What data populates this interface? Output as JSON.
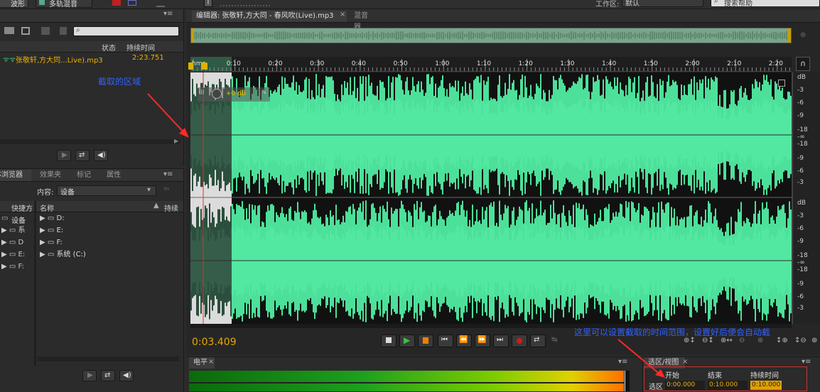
{
  "menubar": {
    "waveform_tab": "波形",
    "multitrack_tab": "多轨混音",
    "workspace_label": "工作区:",
    "workspace_value": "默认",
    "help_search_placeholder": "搜索帮助"
  },
  "files_panel": {
    "col_status": "状态",
    "col_duration": "持续时间",
    "files": [
      {
        "name": "张敬轩,方大同...Live).mp3",
        "duration": "2:23.751"
      }
    ]
  },
  "annotations": {
    "capture_region": "截取的区域",
    "time_range_hint": "这里可以设置截取的时间范围，设置好后便会自动截"
  },
  "browser_panel": {
    "tabs": [
      "媒体浏览器",
      "效果夹",
      "标记",
      "属性"
    ],
    "content_label": "内容:",
    "content_value": "设备",
    "shortcuts_label": "快捷方",
    "devices_label": "设备",
    "left_items": [
      "系",
      "D",
      "E:",
      "F:"
    ],
    "col_name": "名称",
    "col_duration": "持续",
    "drives": [
      "D:",
      "E:",
      "F:",
      "系统 (C:)"
    ]
  },
  "editor": {
    "tab_label": "编辑器: 张敬轩,方大同 - 春风吹(Live).mp3",
    "mixer_tab": "混音器",
    "hud_gain": "+0 dB",
    "current_time": "0:03.409",
    "ruler": [
      "hms",
      "0:10",
      "0:20",
      "0:30",
      "0:40",
      "0:50",
      "1:00",
      "1:10",
      "1:20",
      "1:30",
      "1:40",
      "1:50",
      "2:00",
      "2:10",
      "2:20"
    ],
    "db_scale": [
      "dB",
      "-3",
      "-6",
      "-9",
      "-18",
      "-∞",
      "-18",
      "-9",
      "-6",
      "-3"
    ]
  },
  "meter_panel": {
    "tab": "电平"
  },
  "selection_panel": {
    "tab": "选区/视图",
    "col_start": "开始",
    "col_end": "结束",
    "col_duration": "持续时间",
    "row_label": "选区",
    "start": "0:00.000",
    "end": "0:10.000",
    "duration": "0:10.000"
  },
  "colors": {
    "waveform": "#4de09a",
    "selection": "#3c5a4b",
    "accent": "#f0b000",
    "annotation": "#3060ff",
    "arrow": "#ff2a2a"
  }
}
